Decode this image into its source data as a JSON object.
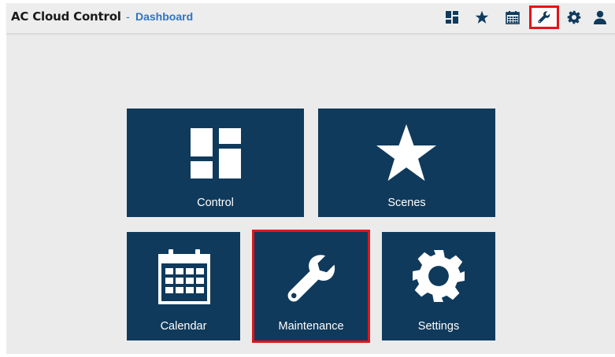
{
  "header": {
    "app_title": "AC Cloud Control",
    "separator": "-",
    "breadcrumb": "Dashboard",
    "toolbar_icons": [
      "dashboard-icon",
      "star-icon",
      "calendar-icon",
      "wrench-icon",
      "gear-icon",
      "user-icon"
    ],
    "active_icon": "wrench-icon"
  },
  "tiles": {
    "control": {
      "label": "Control",
      "icon": "dashboard-icon"
    },
    "scenes": {
      "label": "Scenes",
      "icon": "star-icon"
    },
    "calendar": {
      "label": "Calendar",
      "icon": "calendar-icon"
    },
    "maintenance": {
      "label": "Maintenance",
      "icon": "wrench-icon"
    },
    "settings": {
      "label": "Settings",
      "icon": "gear-icon"
    }
  },
  "colors": {
    "tile_bg": "#0f3a5c",
    "highlight": "#e0151b",
    "breadcrumb": "#2e75c4",
    "page_bg": "#ebebeb"
  }
}
